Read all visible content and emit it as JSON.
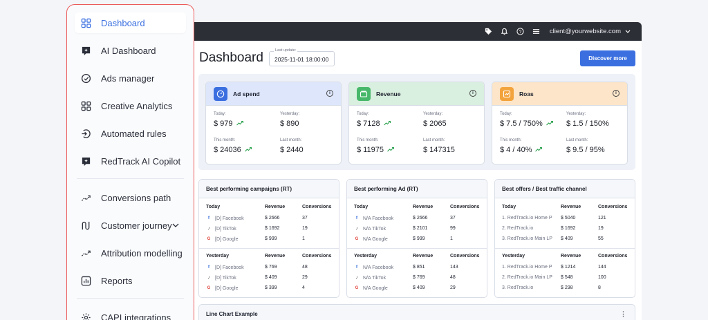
{
  "sidebar": {
    "items": [
      {
        "label": "Dashboard",
        "icon": "grid-icon",
        "active": true
      },
      {
        "label": "AI Dashboard",
        "icon": "ai-chat-icon"
      },
      {
        "label": "Ads manager",
        "icon": "gauge-icon"
      },
      {
        "label": "Creative Analytics",
        "icon": "grid-icon"
      },
      {
        "label": "Automated rules",
        "icon": "rules-icon"
      },
      {
        "label": "RedTrack AI Copilot",
        "icon": "ai-chat-icon"
      },
      {
        "label": "Conversions path",
        "icon": "path-icon"
      },
      {
        "label": "Customer journey",
        "icon": "journey-icon"
      },
      {
        "label": "Attribution modelling",
        "icon": "path-icon"
      },
      {
        "label": "Reports",
        "icon": "report-icon"
      },
      {
        "label": "CAPI integrations",
        "icon": "gear-icon"
      }
    ]
  },
  "topbar": {
    "email": "client@yourwebsite.com"
  },
  "header": {
    "title": "Dashboard",
    "last_update_label": "Last update:",
    "last_update_value": "2025-11-01 18:00:00",
    "discover_label": "Discover more"
  },
  "kpis": [
    {
      "title": "Ad spend",
      "color": "#3b6fe0",
      "bg": "#dde6fb",
      "today_label": "Today:",
      "today": "$ 979",
      "yesterday_label": "Yesterday:",
      "yesterday": "$ 890",
      "month_label": "This month:",
      "month": "$ 24036",
      "lastmonth_label": "Last month:",
      "lastmonth": "$ 2440"
    },
    {
      "title": "Revenue",
      "color": "#47b86a",
      "bg": "#d9efdf",
      "today_label": "Today:",
      "today": "$ 7128",
      "yesterday_label": "Yesterday:",
      "yesterday": "$ 2065",
      "month_label": "This month:",
      "month": "$ 11975",
      "lastmonth_label": "Last month:",
      "lastmonth": "$ 147315"
    },
    {
      "title": "Roas",
      "color": "#f3a33c",
      "bg": "#fce5c9",
      "today_label": "Today:",
      "today": "$ 7.5 / 750%",
      "yesterday_label": "Yesterday:",
      "yesterday": "$ 1.5 / 150%",
      "month_label": "This month:",
      "month": "$ 4 / 40%",
      "lastmonth_label": "Last month:",
      "lastmonth": "$ 9.5 / 95%"
    }
  ],
  "tables": [
    {
      "title": "Best performing campaigns (RT)",
      "sections": [
        {
          "label": "Today",
          "col1": "Revenue",
          "col2": "Conversions",
          "rows": [
            {
              "icon": "facebook-icon",
              "name": "[D] Facebook",
              "rev": "$ 2666",
              "conv": "37"
            },
            {
              "icon": "tiktok-icon",
              "name": "[D] TikTok",
              "rev": "$ 1692",
              "conv": "19"
            },
            {
              "icon": "google-icon",
              "name": "[D] Google",
              "rev": "$ 999",
              "conv": "1"
            }
          ]
        },
        {
          "label": "Yesterday",
          "col1": "Revenue",
          "col2": "Conversions",
          "rows": [
            {
              "icon": "facebook-icon",
              "name": "[D] Facebook",
              "rev": "$ 769",
              "conv": "48"
            },
            {
              "icon": "tiktok-icon",
              "name": "[D] TikTok",
              "rev": "$ 409",
              "conv": "29"
            },
            {
              "icon": "google-icon",
              "name": "[D] Google",
              "rev": "$ 399",
              "conv": "4"
            }
          ]
        }
      ]
    },
    {
      "title": "Best performing Ad (RT)",
      "sections": [
        {
          "label": "Today",
          "col1": "Revenue",
          "col2": "Conversions",
          "rows": [
            {
              "icon": "facebook-icon",
              "name": "N/A Facebook",
              "rev": "$ 2666",
              "conv": "37"
            },
            {
              "icon": "tiktok-icon",
              "name": "N/A TikTok",
              "rev": "$ 2101",
              "conv": "99"
            },
            {
              "icon": "google-icon",
              "name": "N/A Google",
              "rev": "$ 999",
              "conv": "1"
            }
          ]
        },
        {
          "label": "Yesterday",
          "col1": "Revenue",
          "col2": "Conversions",
          "rows": [
            {
              "icon": "facebook-icon",
              "name": "N/A Facebook",
              "rev": "$ 851",
              "conv": "143"
            },
            {
              "icon": "tiktok-icon",
              "name": "N/A TikTok",
              "rev": "$ 769",
              "conv": "48"
            },
            {
              "icon": "google-icon",
              "name": "N/A Google",
              "rev": "$ 409",
              "conv": "29"
            }
          ]
        }
      ]
    },
    {
      "title": "Best offers / Best traffic channel",
      "sections": [
        {
          "label": "Today",
          "col1": "Revenue",
          "col2": "Conversions",
          "rows": [
            {
              "icon": "",
              "name": "1. RedTrack.io Home P",
              "rev": "$ 5040",
              "conv": "121"
            },
            {
              "icon": "",
              "name": "2. RedTrack.io",
              "rev": "$ 1692",
              "conv": "19"
            },
            {
              "icon": "",
              "name": "3. RedTrack.io Main LP",
              "rev": "$ 409",
              "conv": "55"
            }
          ]
        },
        {
          "label": "Yesterday",
          "col1": "Revenue",
          "col2": "Conversions",
          "rows": [
            {
              "icon": "",
              "name": "1. RedTrack.io Home P",
              "rev": "$ 1214",
              "conv": "144"
            },
            {
              "icon": "",
              "name": "2. RedTrack.io Main LP",
              "rev": "$ 548",
              "conv": "100"
            },
            {
              "icon": "",
              "name": "3. RedTrack.io",
              "rev": "$ 298",
              "conv": "8"
            }
          ]
        }
      ]
    }
  ],
  "line_chart": {
    "title": "Line Chart Example"
  }
}
